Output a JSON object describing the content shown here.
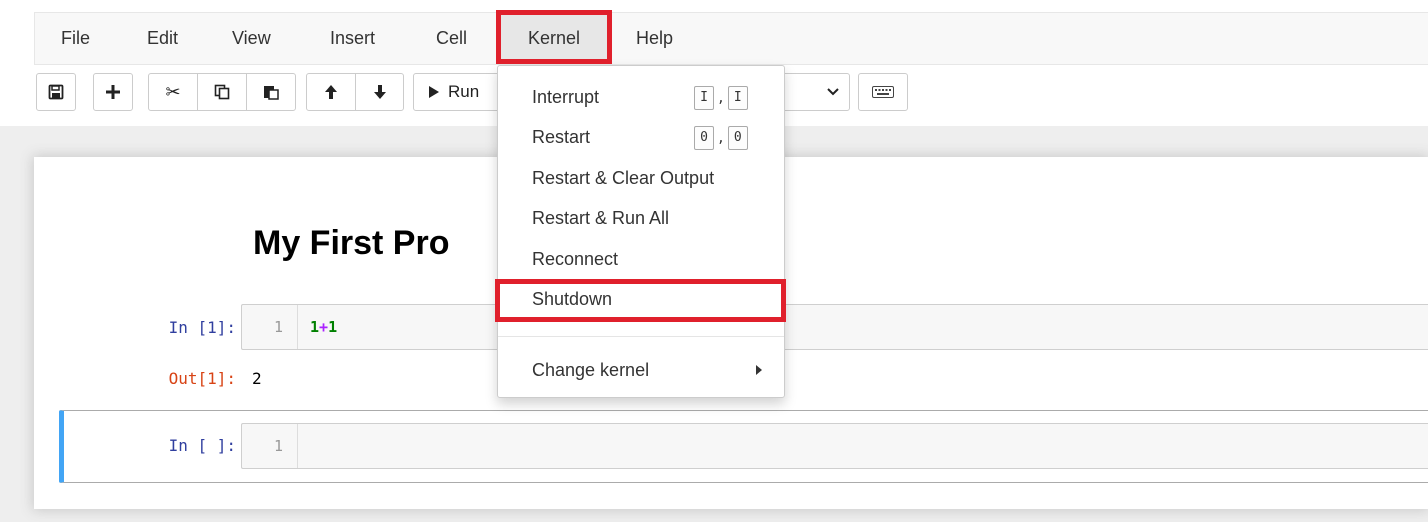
{
  "menubar": {
    "items": [
      "File",
      "Edit",
      "View",
      "Insert",
      "Cell",
      "Kernel",
      "Help"
    ]
  },
  "toolbar": {
    "run_label": "Run",
    "icons": [
      "save-icon",
      "plus-icon",
      "scissors-icon",
      "copy-icon",
      "paste-icon",
      "arrow-up-icon",
      "arrow-down-icon",
      "play-icon",
      "chevron-down-icon",
      "keyboard-icon"
    ]
  },
  "notebook": {
    "heading": "My First Pro",
    "cells": [
      {
        "prompt": "In [1]:",
        "line_number": "1",
        "code_num1": "1",
        "code_op": "+",
        "code_num2": "1"
      },
      {
        "prompt": "In [ ]:",
        "line_number": "1"
      }
    ],
    "output": {
      "prompt": "Out[1]:",
      "value": "2"
    }
  },
  "kernel_menu": {
    "items": [
      {
        "label": "Interrupt",
        "shortcut": [
          "I",
          "I"
        ]
      },
      {
        "label": "Restart",
        "shortcut": [
          "0",
          "0"
        ]
      },
      {
        "label": "Restart & Clear Output"
      },
      {
        "label": "Restart & Run All"
      },
      {
        "label": "Reconnect"
      },
      {
        "label": "Shutdown"
      },
      {
        "label": "Change kernel"
      }
    ],
    "shortcut_separator": ","
  },
  "colors": {
    "highlight": "#e0202c",
    "selected_cell_border": "#42a5f5",
    "in_prompt": "#303f9f",
    "out_prompt": "#d84315"
  }
}
